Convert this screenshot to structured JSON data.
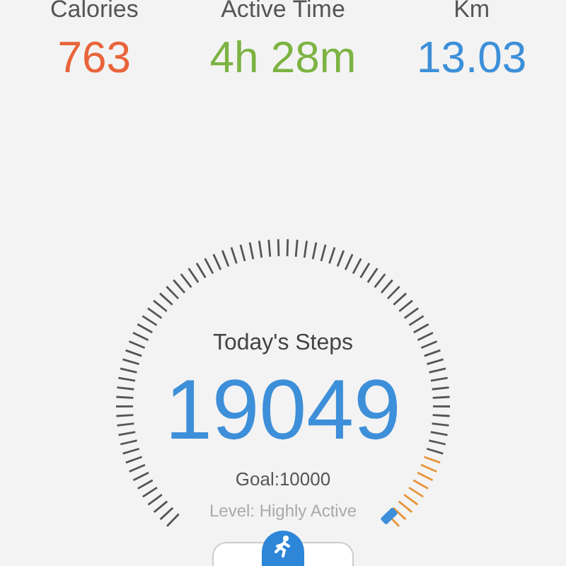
{
  "stats": [
    {
      "label": "Calories",
      "value": "763",
      "color": "#e8643a"
    },
    {
      "label": "Active Time",
      "value": "4h 28m",
      "color": "#7cb342"
    },
    {
      "label": "Km",
      "value": "13.03",
      "color": "#3d8fd9"
    }
  ],
  "steps": {
    "title": "Today's Steps",
    "count": "19049",
    "goal": "Goal:10000",
    "level_text": "Level: Highly Active"
  }
}
